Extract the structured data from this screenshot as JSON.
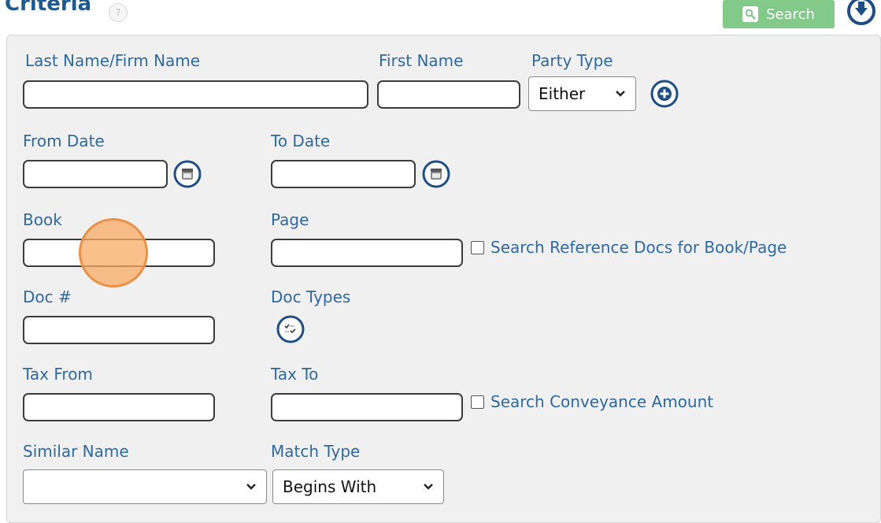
{
  "header": {
    "title": "Criteria",
    "help_glyph": "?",
    "search_label": "Search",
    "search_icon": "magnifier-icon",
    "expand_icon": "expand-down-icon"
  },
  "form": {
    "last_name_label": "Last Name/Firm Name",
    "first_name_label": "First Name",
    "party_type_label": "Party Type",
    "party_type_value": "Either",
    "from_date_label": "From Date",
    "to_date_label": "To Date",
    "book_label": "Book",
    "page_label": "Page",
    "ref_docs_checkbox_label": "Search Reference Docs for Book/Page",
    "doc_num_label": "Doc #",
    "doc_types_label": "Doc Types",
    "tax_from_label": "Tax From",
    "tax_to_label": "Tax To",
    "conveyance_checkbox_label": "Search Conveyance Amount",
    "similar_name_label": "Similar Name",
    "similar_name_value": "",
    "match_type_label": "Match Type",
    "match_type_value": "Begins With"
  },
  "colors": {
    "label": "#2c6aa3",
    "title": "#1d5a8f",
    "search_button": "#82c98a",
    "panel": "#f0f0f0",
    "cursor_highlight": "#f5a55e"
  }
}
